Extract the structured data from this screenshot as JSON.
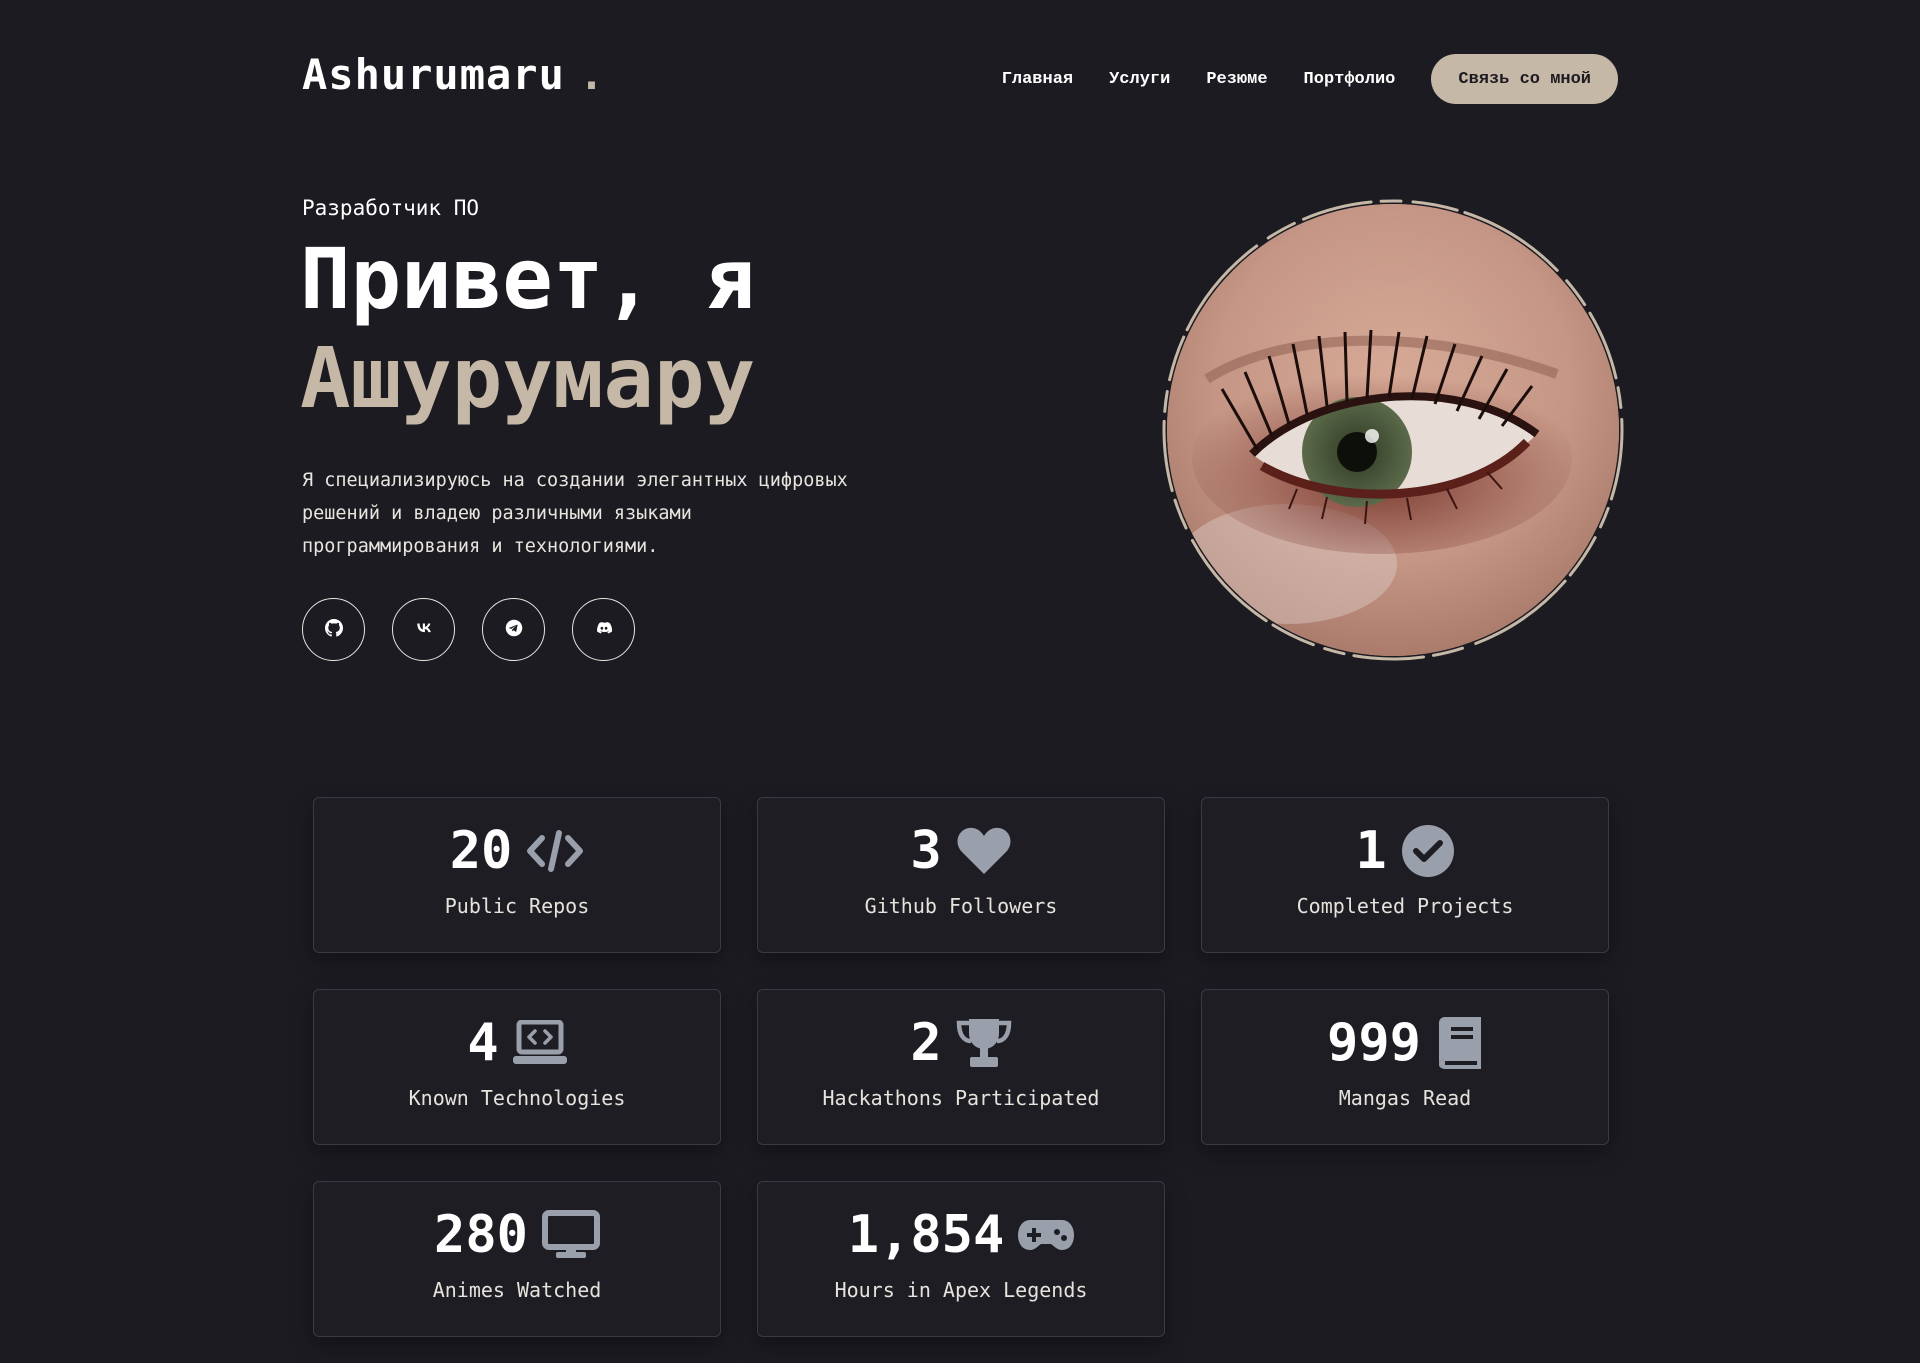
{
  "header": {
    "logo": "Ashurumaru",
    "logo_dot": ".",
    "nav": [
      "Главная",
      "Услуги",
      "Резюме",
      "Портфолио"
    ],
    "contact_label": "Связь со мной"
  },
  "hero": {
    "role": "Разработчик ПО",
    "hello": "Привет, я",
    "name": "Ашурумару",
    "description": "Я специализируюсь на создании элегантных цифровых решений и владею различными языками программирования и технологиями.",
    "socials": [
      "github-icon",
      "vk-icon",
      "telegram-icon",
      "discord-icon"
    ]
  },
  "colors": {
    "background": "#1c1b22",
    "accent": "#c6b8a6",
    "icon_gray": "#9aa0ab"
  },
  "stats": [
    {
      "value": "20",
      "label": "Public Repos",
      "icon": "code-icon"
    },
    {
      "value": "3",
      "label": "Github Followers",
      "icon": "heart-icon"
    },
    {
      "value": "1",
      "label": "Completed Projects",
      "icon": "check-circle-icon"
    },
    {
      "value": "4",
      "label": "Known Technologies",
      "icon": "laptop-code-icon"
    },
    {
      "value": "2",
      "label": "Hackathons Participated",
      "icon": "trophy-icon"
    },
    {
      "value": "999",
      "label": "Mangas Read",
      "icon": "book-icon"
    },
    {
      "value": "280",
      "label": "Animes Watched",
      "icon": "monitor-icon"
    },
    {
      "value": "1,854",
      "label": "Hours in Apex Legends",
      "icon": "gamepad-icon"
    }
  ]
}
